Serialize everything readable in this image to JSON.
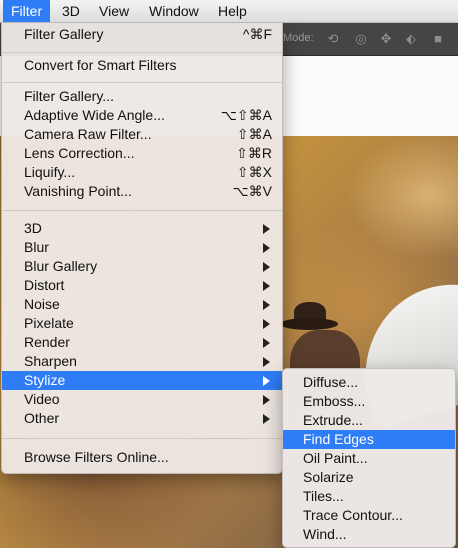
{
  "menubar": {
    "items": [
      {
        "label": "Filter",
        "active": true
      },
      {
        "label": "3D"
      },
      {
        "label": "View"
      },
      {
        "label": "Window"
      },
      {
        "label": "Help"
      }
    ]
  },
  "toolbar": {
    "mode_label": "Mode:",
    "icons": [
      "rotate-3d-icon",
      "roll-3d-icon",
      "pan-3d-icon",
      "slide-3d-icon",
      "video-camera-icon"
    ]
  },
  "filter_menu": {
    "last_filter": {
      "label": "Filter Gallery",
      "shortcut": "^⌘F"
    },
    "convert": {
      "label": "Convert for Smart Filters"
    },
    "filters": [
      {
        "label": "Filter Gallery...",
        "shortcut": ""
      },
      {
        "label": "Adaptive Wide Angle...",
        "shortcut": "⌥⇧⌘A"
      },
      {
        "label": "Camera Raw Filter...",
        "shortcut": "⇧⌘A"
      },
      {
        "label": "Lens Correction...",
        "shortcut": "⇧⌘R"
      },
      {
        "label": "Liquify...",
        "shortcut": "⇧⌘X"
      },
      {
        "label": "Vanishing Point...",
        "shortcut": "⌥⌘V"
      }
    ],
    "submenus": [
      {
        "label": "3D"
      },
      {
        "label": "Blur"
      },
      {
        "label": "Blur Gallery"
      },
      {
        "label": "Distort"
      },
      {
        "label": "Noise"
      },
      {
        "label": "Pixelate"
      },
      {
        "label": "Render"
      },
      {
        "label": "Sharpen"
      },
      {
        "label": "Stylize",
        "highlighted": true
      },
      {
        "label": "Video"
      },
      {
        "label": "Other"
      }
    ],
    "browse": {
      "label": "Browse Filters Online..."
    }
  },
  "stylize_submenu": {
    "items": [
      {
        "label": "Diffuse..."
      },
      {
        "label": "Emboss..."
      },
      {
        "label": "Extrude..."
      },
      {
        "label": "Find Edges",
        "highlighted": true
      },
      {
        "label": "Oil Paint..."
      },
      {
        "label": "Solarize"
      },
      {
        "label": "Tiles..."
      },
      {
        "label": "Trace Contour..."
      },
      {
        "label": "Wind..."
      }
    ]
  },
  "colors": {
    "highlight": "#2e7cf6",
    "menu_background": "#eee8e4"
  }
}
